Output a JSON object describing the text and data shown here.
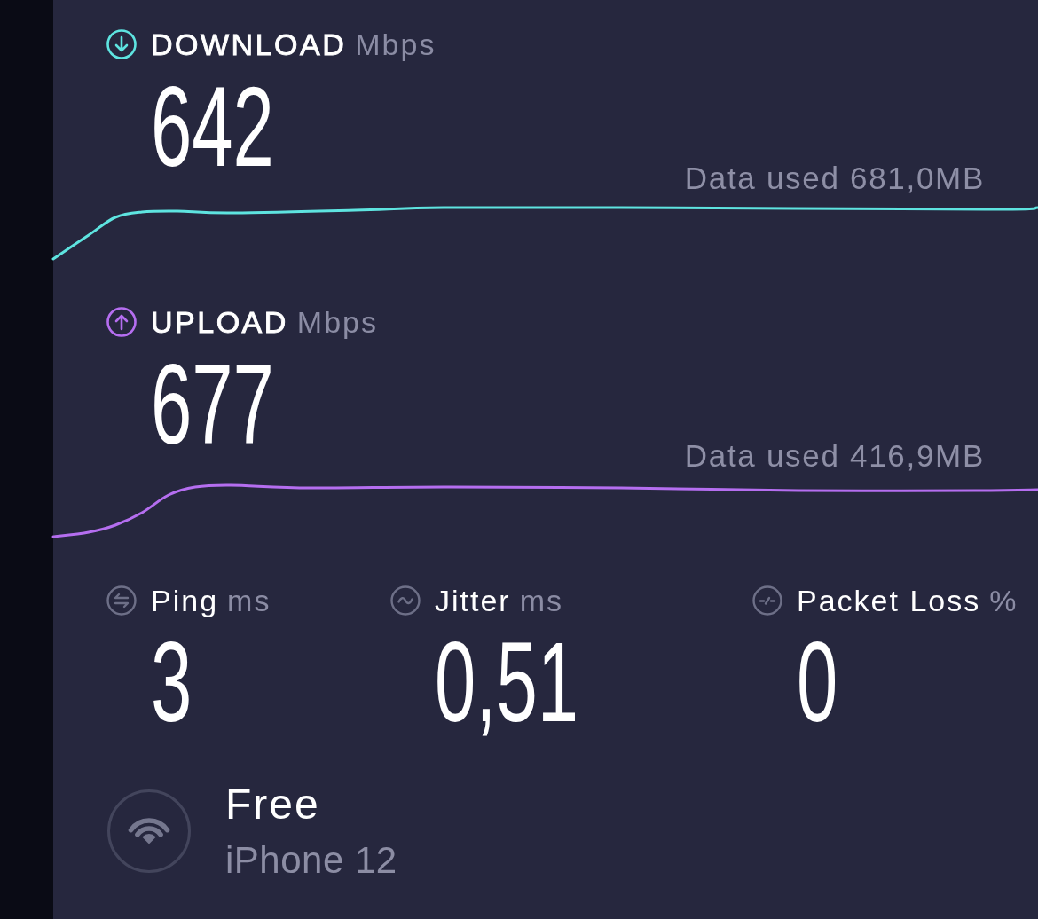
{
  "speed_tests": [
    {
      "kind": "download",
      "label": "DOWNLOAD",
      "unit": "Mbps",
      "value": "642",
      "data_used": "Data used 681,0MB",
      "color": "#5ee4e0"
    },
    {
      "kind": "upload",
      "label": "UPLOAD",
      "unit": "Mbps",
      "value": "677",
      "data_used": "Data used 416,9MB",
      "color": "#b56ef0"
    }
  ],
  "metrics": [
    {
      "kind": "ping",
      "label": "Ping",
      "unit": "ms",
      "value": "3"
    },
    {
      "kind": "jitter",
      "label": "Jitter",
      "unit": "ms",
      "value": "0,51"
    },
    {
      "kind": "packet_loss",
      "label": "Packet Loss",
      "unit": "%",
      "value": "0"
    }
  ],
  "connection": {
    "provider": "Free",
    "device": "iPhone 12"
  }
}
